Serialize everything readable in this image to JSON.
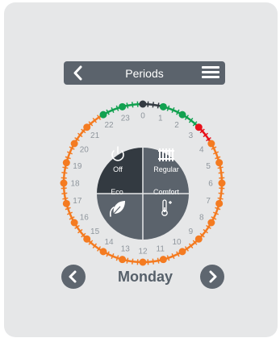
{
  "header": {
    "title": "Periods",
    "back_icon": "chevron-left-icon",
    "menu_icon": "hamburger-menu-icon"
  },
  "dial": {
    "hours": [
      "0",
      "1",
      "2",
      "3",
      "4",
      "5",
      "6",
      "7",
      "8",
      "9",
      "10",
      "11",
      "12",
      "13",
      "14",
      "15",
      "16",
      "17",
      "18",
      "19",
      "20",
      "21",
      "22",
      "23"
    ],
    "slot_colors": [
      "#333a41",
      "#333a41",
      "#333a41",
      "#333a41",
      "#12a150",
      "#12a150",
      "#12a150",
      "#12a150",
      "#12a150",
      "#12a150",
      "#12a150",
      "#12a150",
      "#e8101a",
      "#e8101a",
      "#e8101a",
      "#e8101a",
      "#f47b21",
      "#f47b21",
      "#f47b21",
      "#f47b21",
      "#f47b21",
      "#f47b21",
      "#f47b21",
      "#f47b21",
      "#f47b21",
      "#f47b21",
      "#f47b21",
      "#f47b21",
      "#f47b21",
      "#f47b21",
      "#f47b21",
      "#f47b21",
      "#f47b21",
      "#f47b21",
      "#f47b21",
      "#f47b21",
      "#f47b21",
      "#f47b21",
      "#f47b21",
      "#f47b21",
      "#f47b21",
      "#f47b21",
      "#f47b21",
      "#f47b21",
      "#f47b21",
      "#f47b21",
      "#f47b21",
      "#f47b21",
      "#f47b21",
      "#f47b21",
      "#f47b21",
      "#f47b21",
      "#f47b21",
      "#f47b21",
      "#f47b21",
      "#f47b21",
      "#f47b21",
      "#f47b21",
      "#f47b21",
      "#f47b21",
      "#f47b21",
      "#f47b21",
      "#f47b21",
      "#f47b21",
      "#f47b21",
      "#f47b21",
      "#f47b21",
      "#f47b21",
      "#f47b21",
      "#f47b21",
      "#f47b21",
      "#f47b21",
      "#f47b21",
      "#f47b21",
      "#f47b21",
      "#f47b21",
      "#f47b21",
      "#f47b21",
      "#f47b21",
      "#f47b21",
      "#f47b21",
      "#f47b21",
      "#f47b21",
      "#f47b21",
      "#f47b21",
      "#f47b21",
      "#f47b21",
      "#f47b21",
      "#12a150",
      "#12a150",
      "#12a150",
      "#12a150",
      "#12a150",
      "#12a150",
      "#12a150",
      "#12a150"
    ],
    "modes": {
      "off": {
        "label": "Off",
        "icon": "power-icon"
      },
      "regular": {
        "label": "Regular",
        "icon": "radiator-icon"
      },
      "eco": {
        "label": "Eco",
        "icon": "leaf-icon"
      },
      "comfort": {
        "label": "Comfort",
        "icon": "thermometer-plus-icon"
      }
    }
  },
  "day_nav": {
    "day": "Monday",
    "prev_icon": "chevron-left-circle-icon",
    "next_icon": "chevron-right-circle-icon"
  },
  "colors": {
    "off": "#333a41",
    "regular": "#12a150",
    "comfort": "#e8101a",
    "eco": "#f47b21",
    "panel": "#5b636c"
  }
}
